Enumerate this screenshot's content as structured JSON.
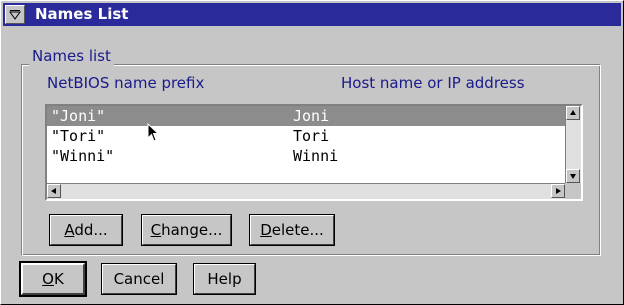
{
  "window": {
    "title": "Names List"
  },
  "names_group": {
    "label": "Names list",
    "column_headers": [
      "NetBIOS name prefix",
      "Host name or IP address"
    ],
    "rows": [
      {
        "prefix": "\"Joni\"",
        "host": "Joni",
        "selected": true
      },
      {
        "prefix": "\"Tori\"",
        "host": "Tori",
        "selected": false
      },
      {
        "prefix": "\"Winni\"",
        "host": "Winni",
        "selected": false
      }
    ],
    "buttons": {
      "add": {
        "mnemonic": "A",
        "rest": "dd..."
      },
      "change": {
        "mnemonic": "C",
        "rest": "hange..."
      },
      "delete": {
        "mnemonic": "D",
        "rest": "elete..."
      }
    }
  },
  "dialog_buttons": {
    "ok": {
      "mnemonic": "O",
      "rest": "K"
    },
    "cancel": "Cancel",
    "help": "Help"
  },
  "colors": {
    "titlebar": "#2a2a9a",
    "label_text": "#1a1a8a",
    "selection": "#8c8c8c",
    "face": "#c6c6c6"
  },
  "icons": {
    "system_menu": "system-menu-icon",
    "cursor": "mouse-pointer-icon"
  }
}
